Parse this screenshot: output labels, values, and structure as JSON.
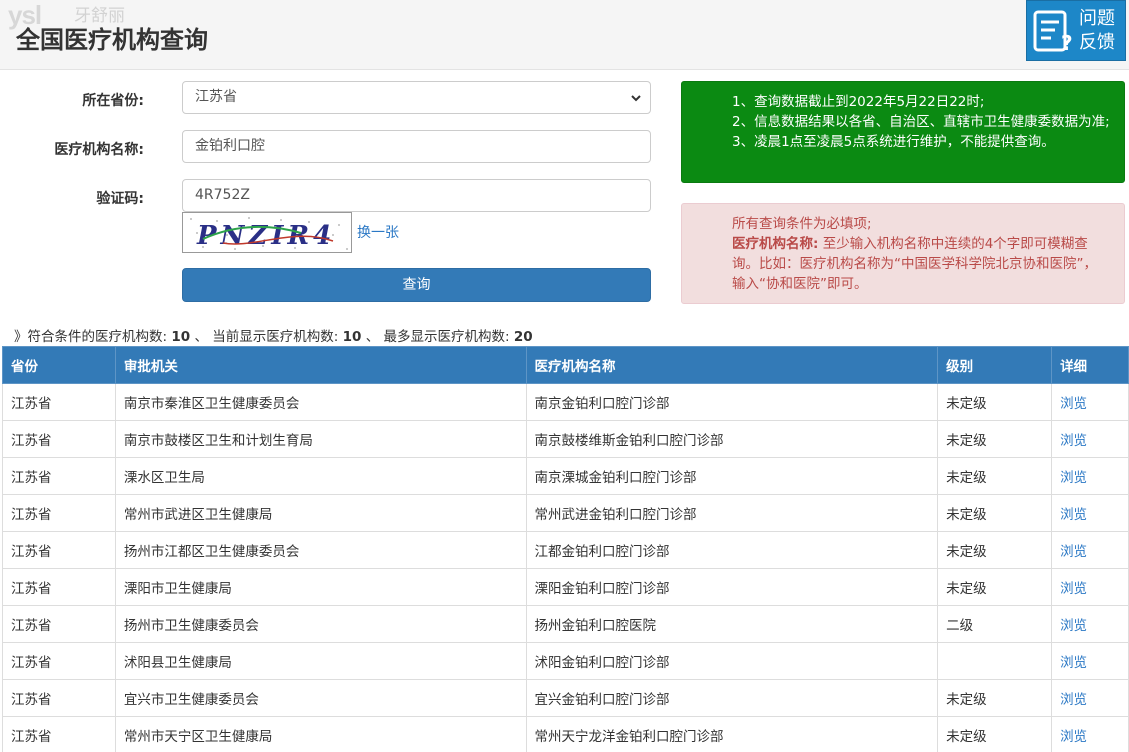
{
  "watermark": {
    "logo": "ysl",
    "text": "牙舒丽"
  },
  "header": {
    "title": "全国医疗机构查询",
    "feedback_label": "问题反馈"
  },
  "form": {
    "province_label": "所在省份:",
    "province_value": "江苏省",
    "name_label": "医疗机构名称:",
    "name_value": "金铂利口腔",
    "captcha_label": "验证码:",
    "captcha_value": "4R752Z",
    "captcha_image_text": "PNZIR4",
    "refresh_label": "换一张",
    "submit_label": "查询"
  },
  "notice": {
    "line1": "1、查询数据截止到2022年5月22日22时;",
    "line2": "2、信息数据结果以各省、自治区、直辖市卫生健康委数据为准;",
    "line3": "3、凌晨1点至凌晨5点系统进行维护，不能提供查询。"
  },
  "hint": {
    "line1": "所有查询条件为必填项;",
    "bold_label": "医疗机构名称:",
    "text": "至少输入机构名称中连续的4个字即可模糊查询。比如：医疗机构名称为“中国医学科学院北京协和医院”，输入“协和医院”即可。"
  },
  "summary": {
    "matched_label": "》符合条件的医疗机构数:",
    "matched_count": "10",
    "sep1": "、",
    "shown_label": "当前显示医疗机构数:",
    "shown_count": "10",
    "sep2": "、",
    "max_label": "最多显示医疗机构数:",
    "max_count": "20"
  },
  "table": {
    "headers": [
      "省份",
      "审批机关",
      "医疗机构名称",
      "级别",
      "详细"
    ],
    "rows": [
      [
        "江苏省",
        "南京市秦淮区卫生健康委员会",
        "南京金铂利口腔门诊部",
        "未定级",
        "浏览"
      ],
      [
        "江苏省",
        "南京市鼓楼区卫生和计划生育局",
        "南京鼓楼维斯金铂利口腔门诊部",
        "未定级",
        "浏览"
      ],
      [
        "江苏省",
        "溧水区卫生局",
        "南京溧城金铂利口腔门诊部",
        "未定级",
        "浏览"
      ],
      [
        "江苏省",
        "常州市武进区卫生健康局",
        "常州武进金铂利口腔门诊部",
        "未定级",
        "浏览"
      ],
      [
        "江苏省",
        "扬州市江都区卫生健康委员会",
        "江都金铂利口腔门诊部",
        "未定级",
        "浏览"
      ],
      [
        "江苏省",
        "溧阳市卫生健康局",
        "溧阳金铂利口腔门诊部",
        "未定级",
        "浏览"
      ],
      [
        "江苏省",
        "扬州市卫生健康委员会",
        "扬州金铂利口腔医院",
        "二级",
        "浏览"
      ],
      [
        "江苏省",
        "沭阳县卫生健康局",
        "沭阳金铂利口腔门诊部",
        "",
        "浏览"
      ],
      [
        "江苏省",
        "宜兴市卫生健康委员会",
        "宜兴金铂利口腔门诊部",
        "未定级",
        "浏览"
      ],
      [
        "江苏省",
        "常州市天宁区卫生健康局",
        "常州天宁龙洋金铂利口腔门诊部",
        "未定级",
        "浏览"
      ]
    ]
  },
  "colors": {
    "primary": "#337ab7",
    "notice_green": "#0b8a12",
    "hint_bg": "#f2dede",
    "hint_text": "#b94a48",
    "link": "#2b78c5"
  }
}
